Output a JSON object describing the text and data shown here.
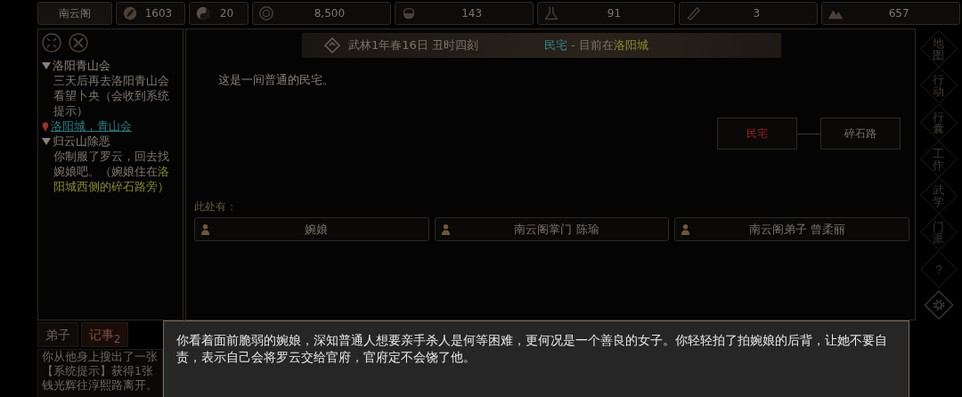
{
  "stats": [
    {
      "kind": "name",
      "value": "南云阁"
    },
    {
      "kind": "leaf",
      "value": "1603"
    },
    {
      "kind": "yinyang",
      "value": "20"
    },
    {
      "kind": "coin",
      "value": "8,500"
    },
    {
      "kind": "bowl",
      "value": "143"
    },
    {
      "kind": "flask",
      "value": "91"
    },
    {
      "kind": "scroll",
      "value": "3"
    },
    {
      "kind": "mountain",
      "value": "657"
    }
  ],
  "quests": [
    {
      "title": "洛阳青山会",
      "expanded": true,
      "description": "三天后再去洛阳青山会看望卜央（会收到系统提示）",
      "location": "洛阳城，青山会"
    },
    {
      "title": "归云山除恶",
      "expanded": true,
      "description": "你制服了罗云，回去找婉娘吧。（婉娘住在",
      "highlight": "洛阳城西侧的碎石路旁）"
    }
  ],
  "header": {
    "date": "武林1年春16日 丑时四刻",
    "place": "民宅",
    "separator": " - 目前在",
    "city": "洛阳城"
  },
  "room_description": "这是一间普通的民宅。",
  "map_nodes": [
    {
      "label": "民宅",
      "selected": true
    },
    {
      "label": "碎石路",
      "selected": false
    }
  ],
  "present_label": "此处有：",
  "npcs": [
    "婉娘",
    "南云阁掌门 陈瑜",
    "南云阁弟子 曾柔丽"
  ],
  "side_menu": [
    {
      "kind": "text",
      "label": "地图"
    },
    {
      "kind": "text",
      "label": "行动"
    },
    {
      "kind": "text",
      "label": "行囊"
    },
    {
      "kind": "text",
      "label": "工作"
    },
    {
      "kind": "text",
      "label": "武学"
    },
    {
      "kind": "text",
      "label": "门派"
    },
    {
      "kind": "text",
      "label": "?"
    },
    {
      "kind": "gear"
    }
  ],
  "tabs": [
    {
      "label": "弟子",
      "selected": false
    },
    {
      "label": "记事$_{2}$",
      "selected": true
    }
  ],
  "log": [
    "你从他身上搜出了一张",
    "【系统提示】获得1张",
    "钱光辉往淳熙路离开。"
  ],
  "dialog": "你看着面前脆弱的婉娘，深知普通人想要亲手杀人是何等困难，更何况是一个善良的女子。你轻轻拍了拍婉娘的后背，让她不要自责，表示自己会将罗云交给官府，官府定不会饶了他。"
}
